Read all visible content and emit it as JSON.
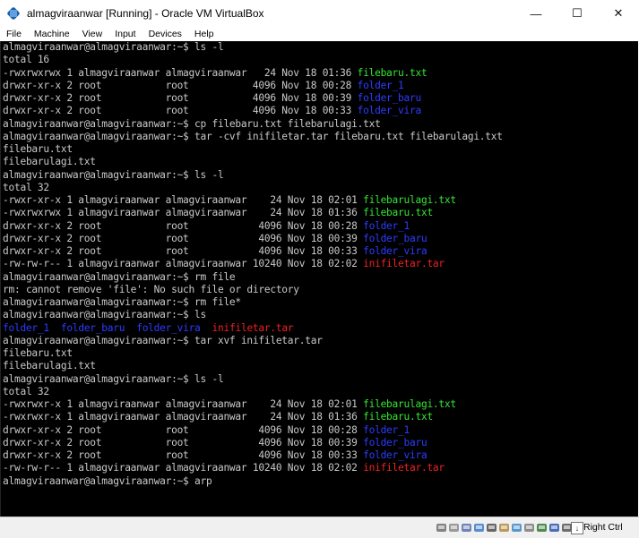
{
  "window": {
    "title": "almagviraanwar [Running] - Oracle VM VirtualBox",
    "minimize_glyph": "—",
    "maximize_glyph": "☐",
    "close_glyph": "✕",
    "menu": [
      "File",
      "Machine",
      "View",
      "Input",
      "Devices",
      "Help"
    ]
  },
  "terminal": {
    "lines": [
      [
        {
          "t": "almagviraanwar@almagviraanwar:~$ ls -l",
          "c": "#c9c9c9"
        }
      ],
      [
        {
          "t": "total 16",
          "c": "#c9c9c9"
        }
      ],
      [
        {
          "t": "-rwxrwxrwx 1 almagviraanwar almagviraanwar   24 Nov 18 01:36 ",
          "c": "#c9c9c9"
        },
        {
          "t": "filebaru.txt",
          "c": "#33e633"
        }
      ],
      [
        {
          "t": "drwxr-xr-x 2 root           root           4096 Nov 18 00:28 ",
          "c": "#c9c9c9"
        },
        {
          "t": "folder_1",
          "c": "#2c3cff"
        }
      ],
      [
        {
          "t": "drwxr-xr-x 2 root           root           4096 Nov 18 00:39 ",
          "c": "#c9c9c9"
        },
        {
          "t": "folder_baru",
          "c": "#2c3cff"
        }
      ],
      [
        {
          "t": "drwxr-xr-x 2 root           root           4096 Nov 18 00:33 ",
          "c": "#c9c9c9"
        },
        {
          "t": "folder_vira",
          "c": "#2c3cff"
        }
      ],
      [
        {
          "t": "almagviraanwar@almagviraanwar:~$ cp filebaru.txt filebarulagi.txt",
          "c": "#c9c9c9"
        }
      ],
      [
        {
          "t": "almagviraanwar@almagviraanwar:~$ tar -cvf inifiletar.tar filebaru.txt filebarulagi.txt",
          "c": "#c9c9c9"
        }
      ],
      [
        {
          "t": "filebaru.txt",
          "c": "#c9c9c9"
        }
      ],
      [
        {
          "t": "filebarulagi.txt",
          "c": "#c9c9c9"
        }
      ],
      [
        {
          "t": "almagviraanwar@almagviraanwar:~$ ls -l",
          "c": "#c9c9c9"
        }
      ],
      [
        {
          "t": "total 32",
          "c": "#c9c9c9"
        }
      ],
      [
        {
          "t": "-rwxr-xr-x 1 almagviraanwar almagviraanwar    24 Nov 18 02:01 ",
          "c": "#c9c9c9"
        },
        {
          "t": "filebarulagi.txt",
          "c": "#33e633"
        }
      ],
      [
        {
          "t": "-rwxrwxrwx 1 almagviraanwar almagviraanwar    24 Nov 18 01:36 ",
          "c": "#c9c9c9"
        },
        {
          "t": "filebaru.txt",
          "c": "#33e633"
        }
      ],
      [
        {
          "t": "drwxr-xr-x 2 root           root            4096 Nov 18 00:28 ",
          "c": "#c9c9c9"
        },
        {
          "t": "folder_1",
          "c": "#2c3cff"
        }
      ],
      [
        {
          "t": "drwxr-xr-x 2 root           root            4096 Nov 18 00:39 ",
          "c": "#c9c9c9"
        },
        {
          "t": "folder_baru",
          "c": "#2c3cff"
        }
      ],
      [
        {
          "t": "drwxr-xr-x 2 root           root            4096 Nov 18 00:33 ",
          "c": "#c9c9c9"
        },
        {
          "t": "folder_vira",
          "c": "#2c3cff"
        }
      ],
      [
        {
          "t": "-rw-rw-r-- 1 almagviraanwar almagviraanwar 10240 Nov 18 02:02 ",
          "c": "#c9c9c9"
        },
        {
          "t": "inifiletar.tar",
          "c": "#ee2222"
        }
      ],
      [
        {
          "t": "almagviraanwar@almagviraanwar:~$ rm file",
          "c": "#c9c9c9"
        }
      ],
      [
        {
          "t": "rm: cannot remove 'file': No such file or directory",
          "c": "#c9c9c9"
        }
      ],
      [
        {
          "t": "almagviraanwar@almagviraanwar:~$ rm file*",
          "c": "#c9c9c9"
        }
      ],
      [
        {
          "t": "almagviraanwar@almagviraanwar:~$ ls",
          "c": "#c9c9c9"
        }
      ],
      [
        {
          "t": "folder_1",
          "c": "#2c3cff"
        },
        {
          "t": "  ",
          "c": "#c9c9c9"
        },
        {
          "t": "folder_baru",
          "c": "#2c3cff"
        },
        {
          "t": "  ",
          "c": "#c9c9c9"
        },
        {
          "t": "folder_vira",
          "c": "#2c3cff"
        },
        {
          "t": "  ",
          "c": "#c9c9c9"
        },
        {
          "t": "inifiletar.tar",
          "c": "#ee2222"
        }
      ],
      [
        {
          "t": "almagviraanwar@almagviraanwar:~$ tar xvf inifiletar.tar",
          "c": "#c9c9c9"
        }
      ],
      [
        {
          "t": "filebaru.txt",
          "c": "#c9c9c9"
        }
      ],
      [
        {
          "t": "filebarulagi.txt",
          "c": "#c9c9c9"
        }
      ],
      [
        {
          "t": "almagviraanwar@almagviraanwar:~$ ls -l",
          "c": "#c9c9c9"
        }
      ],
      [
        {
          "t": "total 32",
          "c": "#c9c9c9"
        }
      ],
      [
        {
          "t": "-rwxrwxr-x 1 almagviraanwar almagviraanwar    24 Nov 18 02:01 ",
          "c": "#c9c9c9"
        },
        {
          "t": "filebarulagi.txt",
          "c": "#33e633"
        }
      ],
      [
        {
          "t": "-rwxrwxr-x 1 almagviraanwar almagviraanwar    24 Nov 18 01:36 ",
          "c": "#c9c9c9"
        },
        {
          "t": "filebaru.txt",
          "c": "#33e633"
        }
      ],
      [
        {
          "t": "drwxr-xr-x 2 root           root            4096 Nov 18 00:28 ",
          "c": "#c9c9c9"
        },
        {
          "t": "folder_1",
          "c": "#2c3cff"
        }
      ],
      [
        {
          "t": "drwxr-xr-x 2 root           root            4096 Nov 18 00:39 ",
          "c": "#c9c9c9"
        },
        {
          "t": "folder_baru",
          "c": "#2c3cff"
        }
      ],
      [
        {
          "t": "drwxr-xr-x 2 root           root            4096 Nov 18 00:33 ",
          "c": "#c9c9c9"
        },
        {
          "t": "folder_vira",
          "c": "#2c3cff"
        }
      ],
      [
        {
          "t": "-rw-rw-r-- 1 almagviraanwar almagviraanwar 10240 Nov 18 02:02 ",
          "c": "#c9c9c9"
        },
        {
          "t": "inifiletar.tar",
          "c": "#ee2222"
        }
      ],
      [
        {
          "t": "almagviraanwar@almagviraanwar:~$ arp",
          "c": "#c9c9c9"
        }
      ]
    ]
  },
  "statusbar": {
    "icons": [
      "hard-disk-icon",
      "optical-drive-icon",
      "audio-icon",
      "network-icon",
      "usb-icon",
      "shared-folder-icon",
      "display-icon",
      "video-capture-icon",
      "mouse-integration-icon",
      "cpu-icon",
      "keyboard-icon"
    ],
    "host_key": "Right Ctrl"
  }
}
